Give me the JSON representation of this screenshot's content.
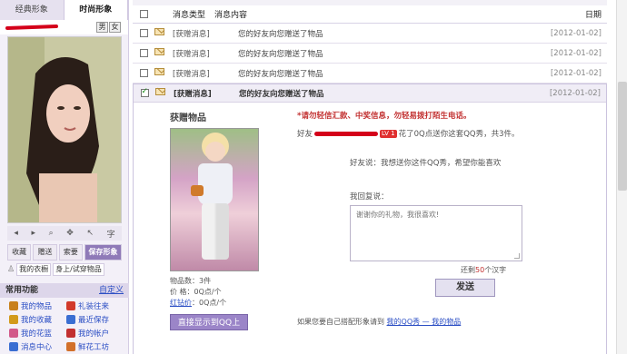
{
  "left": {
    "tabs": [
      "经典形象",
      "时尚形象"
    ],
    "sex": [
      "男",
      "女"
    ],
    "tools": [
      "◂",
      "▸",
      "⌕",
      "✥",
      "↖",
      "字"
    ],
    "actions": {
      "collect": "收藏",
      "gift": "赠送",
      "request": "索要",
      "save": "保存形象"
    },
    "closet": {
      "my_closet": "我的衣橱",
      "try_on": "身上/试穿物品"
    },
    "common": {
      "title": "常用功能",
      "custom": "自定义",
      "items": [
        {
          "label": "我的物品",
          "color": "#c8801c"
        },
        {
          "label": "礼装往来",
          "color": "#d23a2a"
        },
        {
          "label": "我的收藏",
          "color": "#d29a1c"
        },
        {
          "label": "最近保存",
          "color": "#3a6ed2"
        },
        {
          "label": "我的花篮",
          "color": "#d25a8a"
        },
        {
          "label": "我的帐户",
          "color": "#c23030"
        },
        {
          "label": "消息中心",
          "color": "#3a6ed2"
        },
        {
          "label": "鲜花工坊",
          "color": "#d2702a"
        }
      ]
    }
  },
  "list": {
    "header": {
      "type": "消息类型",
      "content": "消息内容",
      "date": "日期"
    },
    "rows": [
      {
        "type": "[获赠消息]",
        "content": "您的好友向您赠送了物品",
        "date": "[2012-01-02]"
      },
      {
        "type": "[获赠消息]",
        "content": "您的好友向您赠送了物品",
        "date": "[2012-01-02]"
      },
      {
        "type": "[获赠消息]",
        "content": "您的好友向您赠送了物品",
        "date": "[2012-01-02]"
      }
    ],
    "expanded": {
      "type": "[获赠消息]",
      "content": "您的好友向您赠送了物品",
      "date": "[2012-01-02]",
      "gift_title": "获赠物品",
      "count": "物品数：3件",
      "price": "价  格：0Q点/个",
      "red_price_label": "红钻价",
      "red_price_value": "：0Q点/个",
      "show_btn": "直接显示到QQ上",
      "warning": "*请勿轻信汇款、中奖信息，勿轻易拨打陌生电话。",
      "friend_prefix": "好友",
      "level": "LV 1",
      "friend_suffix": "花了0Q点送你这套QQ秀，共3件。",
      "friend_says": "好友说：我想送你这件QQ秀，希望你能喜欢",
      "reply_label": "我回复说：",
      "reply_placeholder": "谢谢你的礼物，我很喜欢!",
      "remaining_prefix": "还剩",
      "remaining_num": "50",
      "remaining_suffix": "个汉字",
      "send": "发送",
      "qqshow_prefix": "如果您要自己搭配形象请到",
      "qqshow_link": "我的QQ秀 — 我的物品"
    }
  }
}
